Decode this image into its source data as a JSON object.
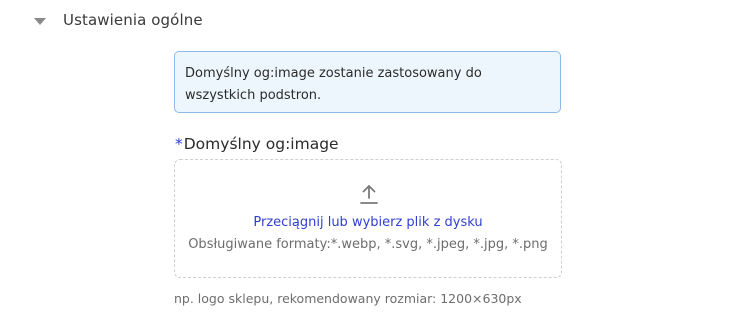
{
  "section": {
    "title": "Ustawienia ogólne",
    "caret_icon": "caret-down-icon"
  },
  "info": {
    "text": "Domyślny og:image zostanie zastosowany do wszystkich podstron."
  },
  "field": {
    "required_mark": "*",
    "label": "Domyślny og:image"
  },
  "upload": {
    "icon": "upload-icon",
    "link_text": "Przeciągnij lub wybierz plik z dysku",
    "formats_text": "Obsługiwane formaty:*.webp, *.svg, *.jpeg, *.jpg, *.png"
  },
  "hint": {
    "text": "np. logo sklepu, rekomendowany rozmiar: 1200×630px"
  },
  "colors": {
    "accent": "#2f3fd1",
    "info_bg": "#eef6fd",
    "info_border": "#8fbce6",
    "dashed_border": "#cfcfcf"
  }
}
